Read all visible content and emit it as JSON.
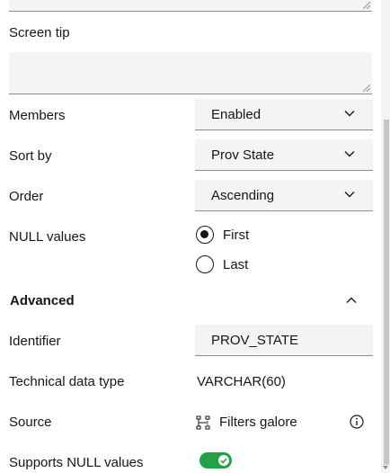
{
  "screen_tip": {
    "label": "Screen tip",
    "value": ""
  },
  "members": {
    "label": "Members",
    "value": "Enabled"
  },
  "sort_by": {
    "label": "Sort by",
    "value": "Prov State"
  },
  "order": {
    "label": "Order",
    "value": "Ascending"
  },
  "null_values": {
    "label": "NULL values",
    "options": [
      "First",
      "Last"
    ],
    "selected": "First"
  },
  "advanced": {
    "title": "Advanced",
    "expanded": true
  },
  "identifier": {
    "label": "Identifier",
    "value": "PROV_STATE"
  },
  "technical_data_type": {
    "label": "Technical data type",
    "value": "VARCHAR(60)"
  },
  "source": {
    "label": "Source",
    "value": "Filters galore",
    "icon": "hierarchy-icon",
    "info_icon": "info-icon"
  },
  "supports_null_values": {
    "label": "Supports NULL values",
    "enabled": true
  },
  "colors": {
    "toggle_on": "#24a148",
    "field_bg": "#f4f4f4",
    "text": "#161616"
  }
}
